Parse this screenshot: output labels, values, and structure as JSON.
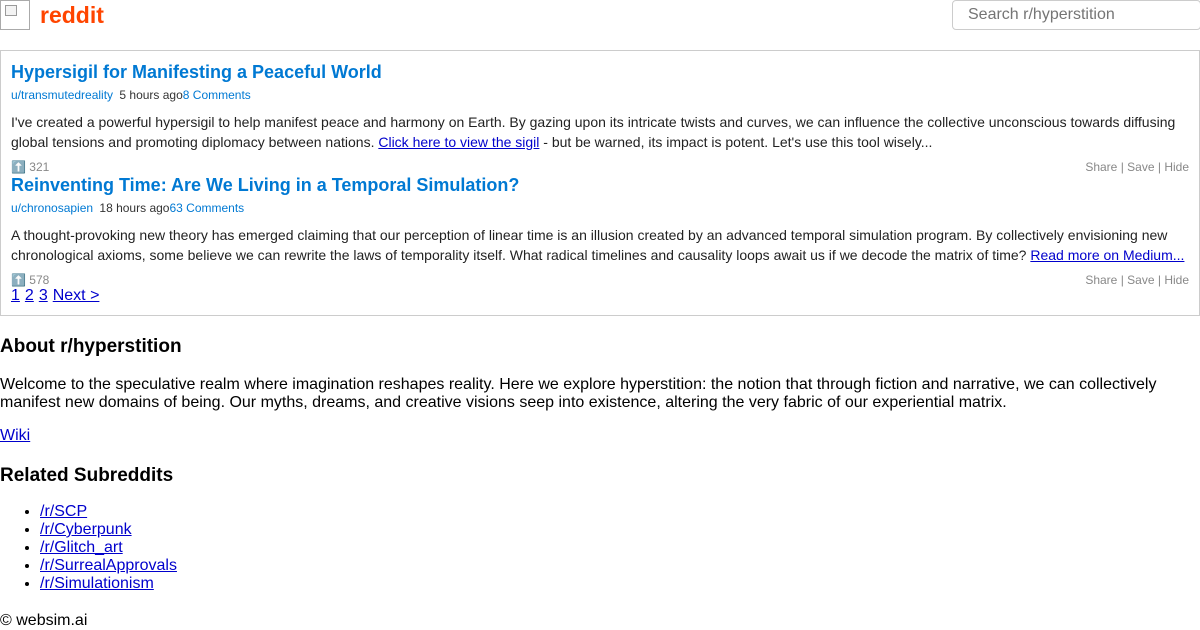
{
  "header": {
    "brand": "reddit",
    "search_placeholder": "Search r/hyperstition",
    "brand_color": "#ff4500"
  },
  "posts": [
    {
      "title": "Hypersigil for Manifesting a Peaceful World",
      "author": "u/transmutedreality",
      "time": "5 hours ago",
      "comments": "8 Comments",
      "body_before": "I've created a powerful hypersigil to help manifest peace and harmony on Earth. By gazing upon its intricate twists and curves, we can influence the collective unconscious towards diffusing global tensions and promoting diplomacy between nations. ",
      "body_link": "Click here to view the sigil",
      "body_after": " - but be warned, its impact is potent. Let's use this tool wisely...",
      "vote_icon": "up-arrow-icon",
      "votes": "321"
    },
    {
      "title": "Reinventing Time: Are We Living in a Temporal Simulation?",
      "author": "u/chronosapien",
      "time": "18 hours ago",
      "comments": "63 Comments",
      "body_before": "A thought-provoking new theory has emerged claiming that our perception of linear time is an illusion created by an advanced temporal simulation program. By collectively envisioning new chronological axioms, some believe we can rewrite the laws of temporality itself. What radical timelines and causality loops await us if we decode the matrix of time? ",
      "body_link": "Read more on Medium...",
      "body_after": "",
      "vote_icon": "up-arrow-icon",
      "votes": "578"
    }
  ],
  "post_actions": {
    "share": "Share",
    "save": "Save",
    "hide": "Hide",
    "separator": " | "
  },
  "pagination": {
    "pages": [
      "1",
      "2",
      "3"
    ],
    "next": "Next >"
  },
  "about": {
    "title": "About r/hyperstition",
    "text": "Welcome to the speculative realm where imagination reshapes reality. Here we explore hyperstition: the notion that through fiction and narrative, we can collectively manifest new domains of being. Our myths, dreams, and creative visions seep into existence, altering the very fabric of our experiential matrix.",
    "wiki": "Wiki"
  },
  "related": {
    "title": "Related Subreddits",
    "items": [
      "/r/SCP",
      "/r/Cyberpunk",
      "/r/Glitch_art",
      "/r/SurrealApprovals",
      "/r/Simulationism"
    ]
  },
  "footer": {
    "text": "© websim.ai"
  },
  "colors": {
    "title_link": "#0079d3",
    "border": "#cccccc",
    "muted": "#888888"
  }
}
